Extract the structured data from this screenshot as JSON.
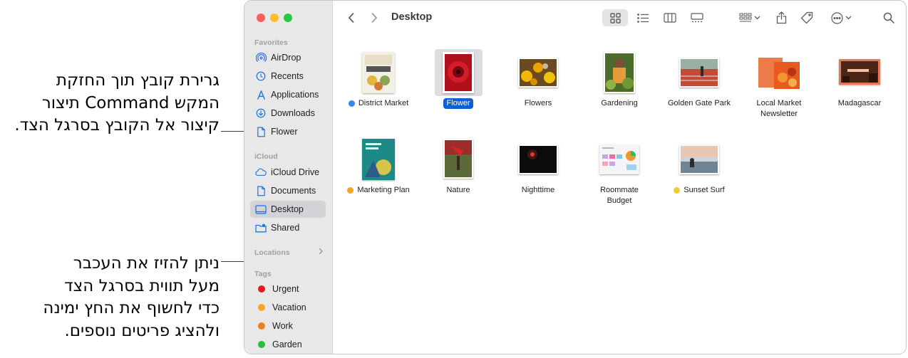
{
  "callouts": {
    "top": [
      "גרירת קובץ תוך החזקת",
      "המקש Command תיצור",
      "קיצור אל הקובץ בסרגל הצד."
    ],
    "bottom": [
      "ניתן להזיז את העכבר",
      "מעל תווית בסרגל הצד",
      "כדי לחשוף את החץ ימינה",
      "ולהציג פריטים נוספים."
    ]
  },
  "window": {
    "title": "Desktop",
    "traffic_lights": [
      "#fe5f57",
      "#febc2e",
      "#28c840"
    ]
  },
  "sidebar": {
    "favorites_header": "Favorites",
    "favorites": [
      {
        "label": "AirDrop",
        "icon": "airdrop-icon"
      },
      {
        "label": "Recents",
        "icon": "clock-icon"
      },
      {
        "label": "Applications",
        "icon": "applications-icon"
      },
      {
        "label": "Downloads",
        "icon": "download-icon"
      },
      {
        "label": "Flower",
        "icon": "document-icon"
      }
    ],
    "icloud_header": "iCloud",
    "icloud": [
      {
        "label": "iCloud Drive",
        "icon": "cloud-icon"
      },
      {
        "label": "Documents",
        "icon": "document-icon"
      },
      {
        "label": "Desktop",
        "icon": "desktop-icon",
        "selected": true
      },
      {
        "label": "Shared",
        "icon": "shared-folder-icon"
      }
    ],
    "locations_header": "Locations",
    "tags_header": "Tags",
    "tags": [
      {
        "label": "Urgent",
        "color": "#e8191a"
      },
      {
        "label": "Vacation",
        "color": "#f5a623"
      },
      {
        "label": "Work",
        "color": "#f07f1b"
      },
      {
        "label": "Garden",
        "color": "#27c03a"
      }
    ]
  },
  "toolbar": {
    "icons": [
      "chevron-left-icon",
      "chevron-right-icon",
      "icon-view-icon",
      "list-view-icon",
      "column-view-icon",
      "gallery-view-icon",
      "group-icon",
      "share-icon",
      "tag-icon",
      "more-icon",
      "search-icon"
    ]
  },
  "files": [
    {
      "name": "District Market",
      "tag": "#2f8af5"
    },
    {
      "name": "Flower",
      "selected": true
    },
    {
      "name": "Flowers"
    },
    {
      "name": "Gardening"
    },
    {
      "name": "Golden Gate Park"
    },
    {
      "name": "Local Market Newsletter"
    },
    {
      "name": "Madagascar"
    },
    {
      "name": "Marketing Plan",
      "tag": "#f5a623"
    },
    {
      "name": "Nature"
    },
    {
      "name": "Nighttime"
    },
    {
      "name": "Roommate Budget"
    },
    {
      "name": "Sunset Surf",
      "tag": "#f5cb2e"
    }
  ]
}
